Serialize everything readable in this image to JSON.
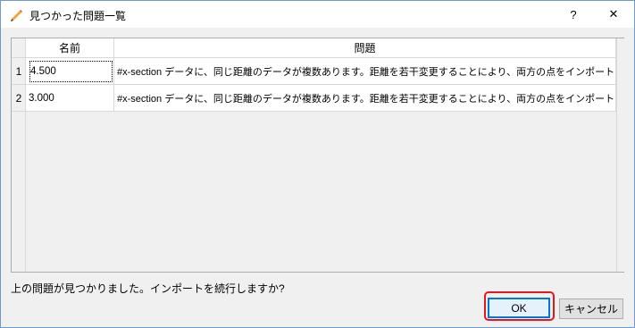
{
  "window": {
    "title": "見つかった問題一覧",
    "help_label": "?",
    "close_label": "✕",
    "title_icon": "pencil-icon"
  },
  "table": {
    "columns": [
      "名前",
      "問題"
    ],
    "rows": [
      {
        "num": "1",
        "name": "4.500",
        "problem": "#x-section データに、同じ距離のデータが複数あります。距離を若干変更することにより、両方の点をインポートします。"
      },
      {
        "num": "2",
        "name": "3.000",
        "problem": "#x-section データに、同じ距離のデータが複数あります。距離を若干変更することにより、両方の点をインポートします。"
      }
    ]
  },
  "message": "上の問題が見つかりました。インポートを続行しますか?",
  "buttons": {
    "ok": "OK",
    "cancel": "キャンセル"
  },
  "colors": {
    "highlight": "#e8141e",
    "ok_border": "#0078d7"
  }
}
